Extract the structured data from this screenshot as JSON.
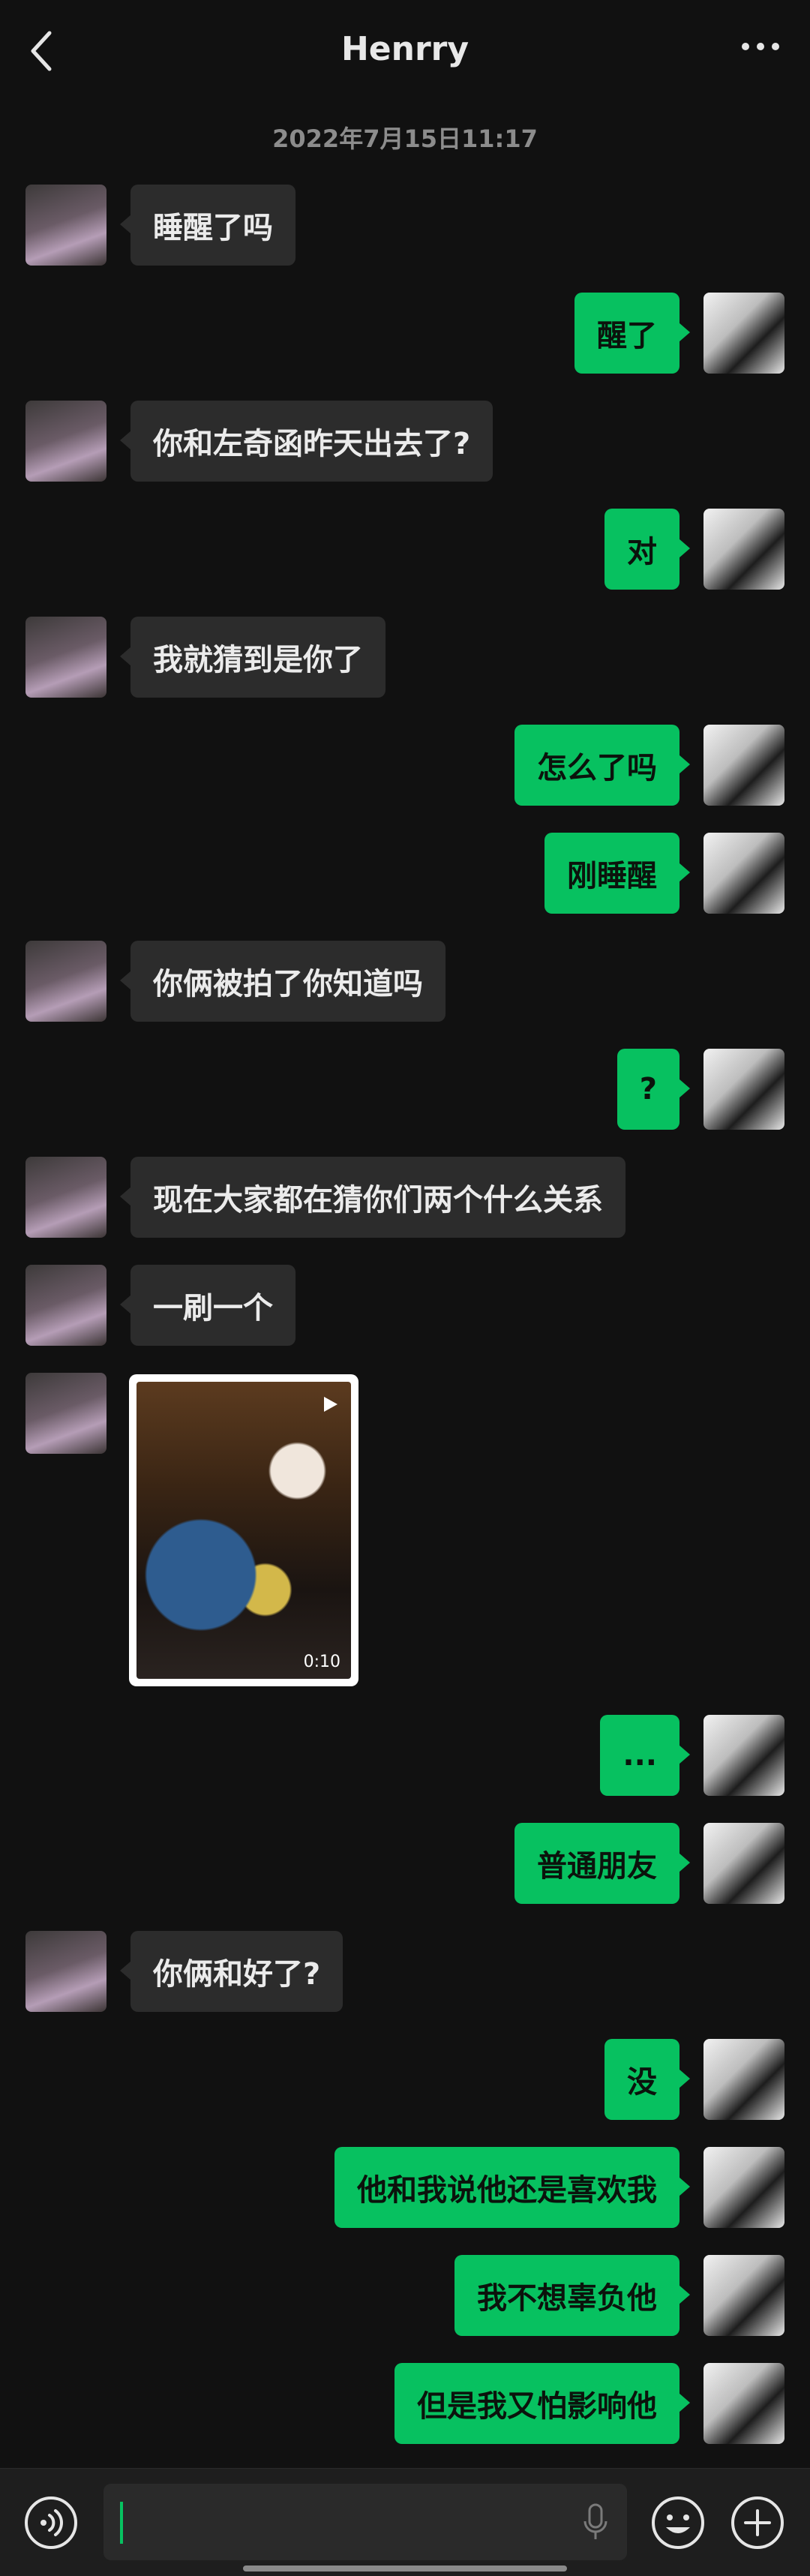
{
  "header": {
    "title": "Henrry"
  },
  "timestamp": "2022年7月15日11:17",
  "messages": [
    {
      "side": "left",
      "text": "睡醒了吗"
    },
    {
      "side": "right",
      "text": "醒了"
    },
    {
      "side": "left",
      "text": "你和左奇函昨天出去了?"
    },
    {
      "side": "right",
      "text": "对"
    },
    {
      "side": "left",
      "text": "我就猜到是你了"
    },
    {
      "side": "right",
      "text": "怎么了吗"
    },
    {
      "side": "right",
      "text": "刚睡醒"
    },
    {
      "side": "left",
      "text": "你俩被拍了你知道吗"
    },
    {
      "side": "right",
      "text": "?"
    },
    {
      "side": "left",
      "text": "现在大家都在猜你们两个什么关系"
    },
    {
      "side": "left",
      "text": "一刷一个"
    },
    {
      "side": "right",
      "text": "..."
    },
    {
      "side": "right",
      "text": "普通朋友"
    },
    {
      "side": "left",
      "text": "你俩和好了?"
    },
    {
      "side": "right",
      "text": "没"
    },
    {
      "side": "right",
      "text": "他和我说他还是喜欢我"
    },
    {
      "side": "right",
      "text": "我不想辜负他"
    },
    {
      "side": "right",
      "text": "但是我又怕影响他"
    }
  ],
  "video_message": {
    "duration": "0:10"
  },
  "icons": {
    "back": "chevron-left-icon",
    "more": "more-dots-icon",
    "voice": "voice-icon",
    "mic": "mic-icon",
    "emoji": "emoji-icon",
    "add": "add-icon",
    "play": "play-icon"
  },
  "colors": {
    "background": "#111111",
    "bubble_left": "#2c2c2c",
    "bubble_right": "#07c160"
  }
}
